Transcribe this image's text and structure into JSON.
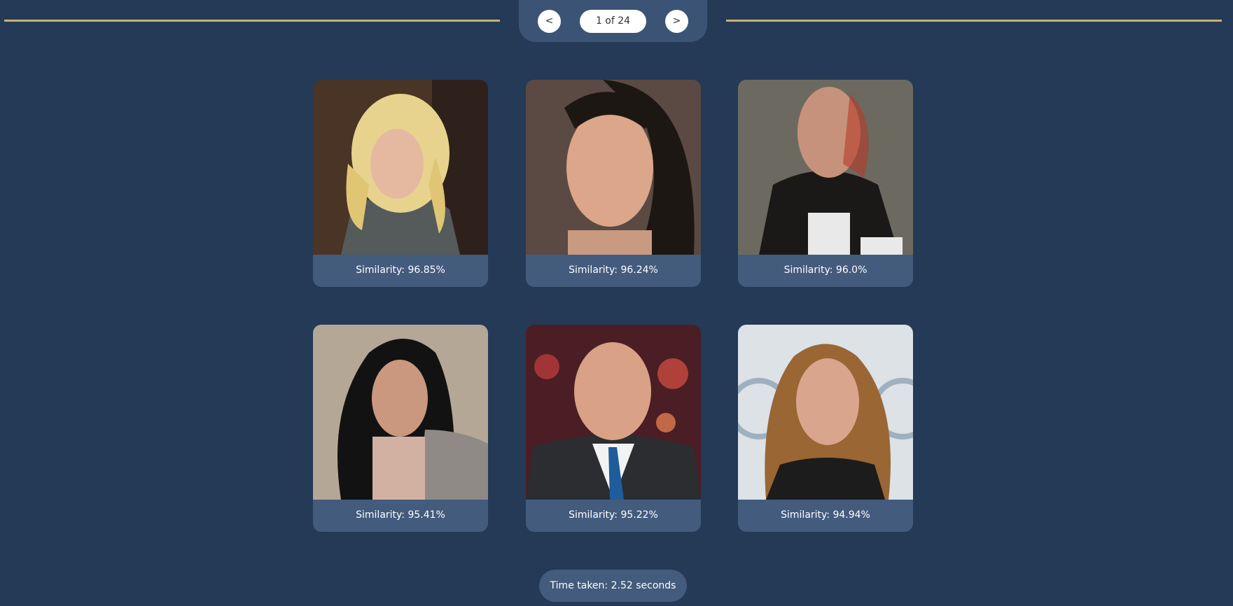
{
  "pager": {
    "prev_label": "<",
    "next_label": ">",
    "indicator": "1 of 24"
  },
  "results": [
    {
      "similarity": "Similarity: 96.85%"
    },
    {
      "similarity": "Similarity: 96.24%"
    },
    {
      "similarity": "Similarity: 96.0%"
    },
    {
      "similarity": "Similarity: 95.41%"
    },
    {
      "similarity": "Similarity: 95.22%"
    },
    {
      "similarity": "Similarity: 94.94%"
    }
  ],
  "footer": {
    "time_taken": "Time taken: 2.52 seconds"
  },
  "colors": {
    "background": "#243a56",
    "panel": "#435b7c",
    "rule": "#c9b07a"
  }
}
